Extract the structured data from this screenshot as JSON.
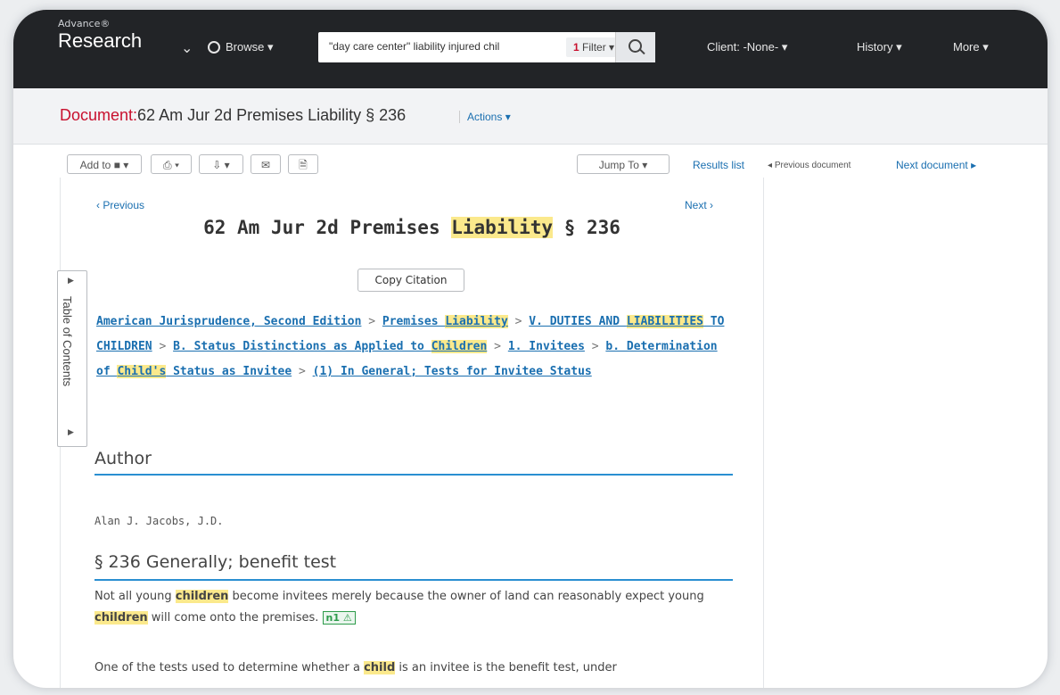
{
  "brand": {
    "super": "Advance®",
    "main": "Research"
  },
  "nav": {
    "browse": "Browse",
    "search_query": "\"day care center\" liability injured chil",
    "filter_count": "1",
    "filter_label": "Filter",
    "client": "Client: -None-",
    "history": "History",
    "more": "More"
  },
  "doc": {
    "label": "Document:",
    "title": "62 Am Jur 2d Premises Liability § 236",
    "actions": "Actions"
  },
  "toolbar": {
    "add_to": "Add to",
    "jump_to": "Jump To",
    "results_list": "Results list",
    "previous_document": "Previous document",
    "next_document": "Next document"
  },
  "content": {
    "previous": "Previous",
    "next": "Next",
    "heading_pre": "62 Am Jur 2d Premises ",
    "heading_hl": "Liability",
    "heading_post": " § 236",
    "copy_citation": "Copy Citation",
    "toc_label": "Table of Contents",
    "crumbs": {
      "c1": "American Jurisprudence, Second Edition",
      "c2a": "Premises ",
      "c2b": "Liability",
      "c3a": "V. DUTIES AND ",
      "c3b": "LIABILITIES",
      "c3c": " TO CHILDREN",
      "c4a": "B. Status Distinctions as Applied to ",
      "c4b": "Children",
      "c5": "1. Invitees",
      "c6a": "b. Determination of ",
      "c6b": "Child's",
      "c6c": " Status as Invitee",
      "c7": "(1) In General; Tests for Invitee Status"
    },
    "author_heading": "Author",
    "author_name": "Alan J. Jacobs, J.D.",
    "section_heading": "§ 236 Generally; benefit test",
    "p1_a": "Not all young ",
    "p1_b": "children",
    "p1_c": " become invitees merely because the owner of land can reasonably expect young ",
    "p1_d": "children",
    "p1_e": " will come onto the premises.",
    "p1_fn": "n1",
    "p2_a": "One of the tests used to determine whether a ",
    "p2_b": "child",
    "p2_c": " is an invitee is the benefit test, under"
  },
  "colors": {
    "accent_red": "#c8102e",
    "link_blue": "#1a6fb0",
    "highlight": "#fbe98c",
    "rule_blue": "#2a8fd1"
  }
}
